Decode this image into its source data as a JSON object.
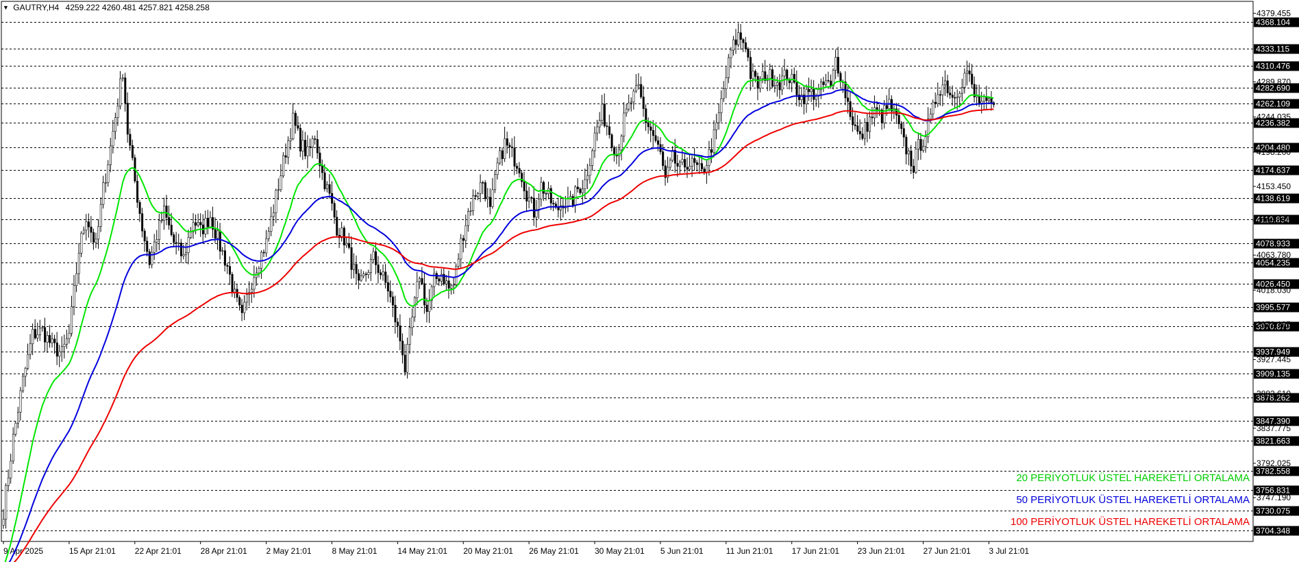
{
  "header": {
    "symbol": "GAUTRY,H4",
    "ohlc": "4259.222 4260.481 4257.821 4258.258"
  },
  "legend": {
    "ema20": "20 PERİYOTLUK ÜSTEL HAREKETLİ ORTALAMA",
    "ema50": "50 PERİYOTLUK ÜSTEL HAREKETLİ ORTALAMA",
    "ema100": "100 PERİYOTLUK ÜSTEL HAREKETLİ ORTALAMA"
  },
  "colors": {
    "ema20": "#00e600",
    "ema50": "#0000dd",
    "ema100": "#ee0000",
    "candle": "#000000",
    "grid": "#000000",
    "background": "#ffffff"
  },
  "chart_data": {
    "type": "line",
    "title": "GAUTRY,H4",
    "ylim": [
      3690,
      4395
    ],
    "y_tick_labels": [
      "4379.455",
      "4289.870",
      "4244.035",
      "4198.200",
      "4153.450",
      "4108.615",
      "4063.780",
      "4018.030",
      "3973.195",
      "3927.445",
      "3882.610",
      "3837.775",
      "3792.025",
      "3747.190"
    ],
    "y_ticks": [
      4379.455,
      4289.87,
      4244.035,
      4198.2,
      4153.45,
      4108.615,
      4063.78,
      4018.03,
      3973.195,
      3927.445,
      3882.61,
      3837.775,
      3792.025,
      3747.19
    ],
    "level_lines": [
      4368.104,
      4333.115,
      4310.476,
      4282.69,
      4262.109,
      4236.382,
      4204.48,
      4174.637,
      4138.619,
      4110.834,
      4078.933,
      4054.235,
      4026.45,
      3995.577,
      3970.879,
      3937.949,
      3909.135,
      3878.262,
      3847.39,
      3821.663,
      3782.558,
      3756.831,
      3730.075,
      3704.348
    ],
    "level_labels": [
      "4368.104",
      "4333.115",
      "4310.476",
      "4282.690",
      "4262.109",
      "4236.382",
      "4204.480",
      "4174.637",
      "4138.619",
      "4110.834",
      "4078.933",
      "4054.235",
      "4026.450",
      "3995.577",
      "3970.879",
      "3937.949",
      "3909.135",
      "3878.262",
      "3847.390",
      "3821.663",
      "3782.558",
      "3756.831",
      "3730.075",
      "3704.348"
    ],
    "x_labels": [
      "9 Apr 2025",
      "15 Apr 21:01",
      "22 Apr 21:01",
      "28 Apr 21:01",
      "2 May 21:01",
      "8 May 21:01",
      "14 May 21:01",
      "20 May 21:01",
      "26 May 21:01",
      "30 May 21:01",
      "5 Jun 21:01",
      "11 Jun 21:01",
      "17 Jun 21:01",
      "23 Jun 21:01",
      "27 Jun 21:01",
      "3 Jul 21:01"
    ],
    "x_label_bars": [
      0,
      27,
      54,
      81,
      108,
      135,
      162,
      189,
      216,
      243,
      270,
      297,
      324,
      351,
      378,
      405
    ],
    "bar_count": 408,
    "price_path": [
      [
        0,
        3730
      ],
      [
        4,
        3825
      ],
      [
        8,
        3900
      ],
      [
        12,
        3960
      ],
      [
        16,
        3965
      ],
      [
        20,
        3945
      ],
      [
        24,
        3935
      ],
      [
        27,
        3960
      ],
      [
        31,
        4070
      ],
      [
        34,
        4115
      ],
      [
        38,
        4075
      ],
      [
        41,
        4150
      ],
      [
        44,
        4205
      ],
      [
        46,
        4245
      ],
      [
        49,
        4305
      ],
      [
        51,
        4225
      ],
      [
        54,
        4160
      ],
      [
        57,
        4100
      ],
      [
        60,
        4055
      ],
      [
        63,
        4090
      ],
      [
        66,
        4120
      ],
      [
        70,
        4080
      ],
      [
        74,
        4060
      ],
      [
        78,
        4110
      ],
      [
        81,
        4095
      ],
      [
        85,
        4115
      ],
      [
        89,
        4075
      ],
      [
        92,
        4050
      ],
      [
        95,
        4010
      ],
      [
        98,
        3980
      ],
      [
        101,
        4020
      ],
      [
        104,
        4050
      ],
      [
        108,
        4080
      ],
      [
        112,
        4140
      ],
      [
        116,
        4200
      ],
      [
        119,
        4240
      ],
      [
        122,
        4210
      ],
      [
        125,
        4195
      ],
      [
        128,
        4220
      ],
      [
        131,
        4170
      ],
      [
        134,
        4140
      ],
      [
        137,
        4100
      ],
      [
        140,
        4085
      ],
      [
        143,
        4055
      ],
      [
        146,
        4020
      ],
      [
        149,
        4040
      ],
      [
        152,
        4060
      ],
      [
        155,
        4040
      ],
      [
        158,
        4020
      ],
      [
        161,
        3980
      ],
      [
        164,
        3940
      ],
      [
        165,
        3915
      ],
      [
        168,
        3980
      ],
      [
        171,
        4040
      ],
      [
        174,
        3990
      ],
      [
        177,
        4030
      ],
      [
        180,
        4040
      ],
      [
        183,
        4020
      ],
      [
        185,
        4025
      ],
      [
        188,
        4080
      ],
      [
        191,
        4120
      ],
      [
        194,
        4145
      ],
      [
        197,
        4160
      ],
      [
        200,
        4120
      ],
      [
        203,
        4180
      ],
      [
        206,
        4210
      ],
      [
        209,
        4195
      ],
      [
        212,
        4180
      ],
      [
        215,
        4145
      ],
      [
        218,
        4120
      ],
      [
        221,
        4155
      ],
      [
        224,
        4140
      ],
      [
        227,
        4120
      ],
      [
        230,
        4135
      ],
      [
        233,
        4130
      ],
      [
        236,
        4150
      ],
      [
        239,
        4160
      ],
      [
        243,
        4220
      ],
      [
        246,
        4250
      ],
      [
        249,
        4225
      ],
      [
        252,
        4195
      ],
      [
        255,
        4240
      ],
      [
        258,
        4265
      ],
      [
        261,
        4280
      ],
      [
        264,
        4240
      ],
      [
        267,
        4220
      ],
      [
        270,
        4195
      ],
      [
        272,
        4160
      ],
      [
        275,
        4190
      ],
      [
        278,
        4175
      ],
      [
        281,
        4185
      ],
      [
        284,
        4180
      ],
      [
        287,
        4170
      ],
      [
        290,
        4195
      ],
      [
        293,
        4230
      ],
      [
        296,
        4280
      ],
      [
        299,
        4330
      ],
      [
        302,
        4350
      ],
      [
        305,
        4340
      ],
      [
        307,
        4300
      ],
      [
        310,
        4285
      ],
      [
        313,
        4300
      ],
      [
        316,
        4295
      ],
      [
        319,
        4290
      ],
      [
        322,
        4300
      ],
      [
        325,
        4285
      ],
      [
        328,
        4270
      ],
      [
        331,
        4275
      ],
      [
        335,
        4275
      ],
      [
        338,
        4290
      ],
      [
        340,
        4280
      ],
      [
        342,
        4320
      ],
      [
        344,
        4300
      ],
      [
        346,
        4275
      ],
      [
        348,
        4250
      ],
      [
        350,
        4230
      ],
      [
        352,
        4215
      ],
      [
        355,
        4235
      ],
      [
        358,
        4250
      ],
      [
        361,
        4245
      ],
      [
        364,
        4260
      ],
      [
        367,
        4240
      ],
      [
        370,
        4210
      ],
      [
        372,
        4195
      ],
      [
        374,
        4180
      ],
      [
        376,
        4205
      ],
      [
        378,
        4215
      ],
      [
        381,
        4240
      ],
      [
        384,
        4280
      ],
      [
        387,
        4290
      ],
      [
        390,
        4270
      ],
      [
        393,
        4285
      ],
      [
        396,
        4305
      ],
      [
        399,
        4270
      ],
      [
        402,
        4262
      ],
      [
        405,
        4258
      ]
    ],
    "series": [
      {
        "name": "20 PERİYOTLUK ÜSTEL HAREKETLİ ORTALAMA",
        "period": 20
      },
      {
        "name": "50 PERİYOTLUK ÜSTEL HAREKETLİ ORTALAMA",
        "period": 50
      },
      {
        "name": "100 PERİYOTLUK ÜSTEL HAREKETLİ ORTALAMA",
        "period": 100
      }
    ],
    "grid": false
  }
}
